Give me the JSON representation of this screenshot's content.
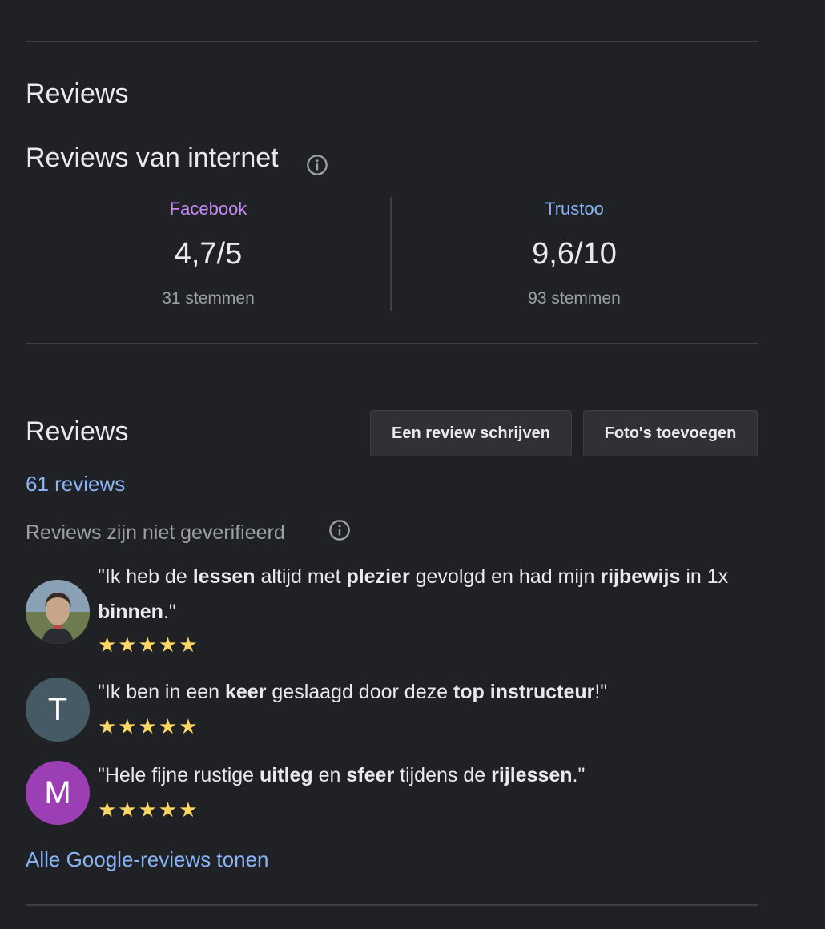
{
  "section_title": "Reviews",
  "web_reviews": {
    "title": "Reviews van internet",
    "sources": [
      {
        "name": "Facebook",
        "score": "4,7/5",
        "votes": "31 stemmen",
        "color": "#c58af9"
      },
      {
        "name": "Trustoo",
        "score": "9,6/10",
        "votes": "93 stemmen",
        "color": "#8ab4f8"
      }
    ]
  },
  "google_reviews": {
    "title": "Reviews",
    "write_button": "Een review schrijven",
    "photos_button": "Foto's toevoegen",
    "count_link": "61 reviews",
    "disclaimer": "Reviews zijn niet geverifieerd",
    "reviews": [
      {
        "avatar_letter": "",
        "avatar_color": "#6b7b6a",
        "segments": [
          {
            "t": "\"Ik heb de ",
            "b": false
          },
          {
            "t": "lessen",
            "b": true
          },
          {
            "t": " altijd met ",
            "b": false
          },
          {
            "t": "plezier",
            "b": true
          },
          {
            "t": " gevolgd en had mijn ",
            "b": false
          },
          {
            "t": "rijbewijs",
            "b": true
          },
          {
            "t": " in 1x ",
            "b": false
          },
          {
            "t": "binnen",
            "b": true
          },
          {
            "t": ".\"",
            "b": false
          }
        ],
        "stars": "★★★★★",
        "rating": 5
      },
      {
        "avatar_letter": "T",
        "avatar_color": "#455a64",
        "segments": [
          {
            "t": "\"Ik ben in een ",
            "b": false
          },
          {
            "t": "keer",
            "b": true
          },
          {
            "t": " geslaagd door deze ",
            "b": false
          },
          {
            "t": "top instructeur",
            "b": true
          },
          {
            "t": "!\"",
            "b": false
          }
        ],
        "stars": "★★★★★",
        "rating": 5
      },
      {
        "avatar_letter": "M",
        "avatar_color": "#9c3fb5",
        "segments": [
          {
            "t": "\"Hele fijne rustige ",
            "b": false
          },
          {
            "t": "uitleg",
            "b": true
          },
          {
            "t": " en ",
            "b": false
          },
          {
            "t": "sfeer",
            "b": true
          },
          {
            "t": " tijdens de ",
            "b": false
          },
          {
            "t": "rijlessen",
            "b": true
          },
          {
            "t": ".\"",
            "b": false
          }
        ],
        "stars": "★★★★★",
        "rating": 5
      }
    ],
    "all_reviews_link": "Alle Google-reviews tonen"
  }
}
